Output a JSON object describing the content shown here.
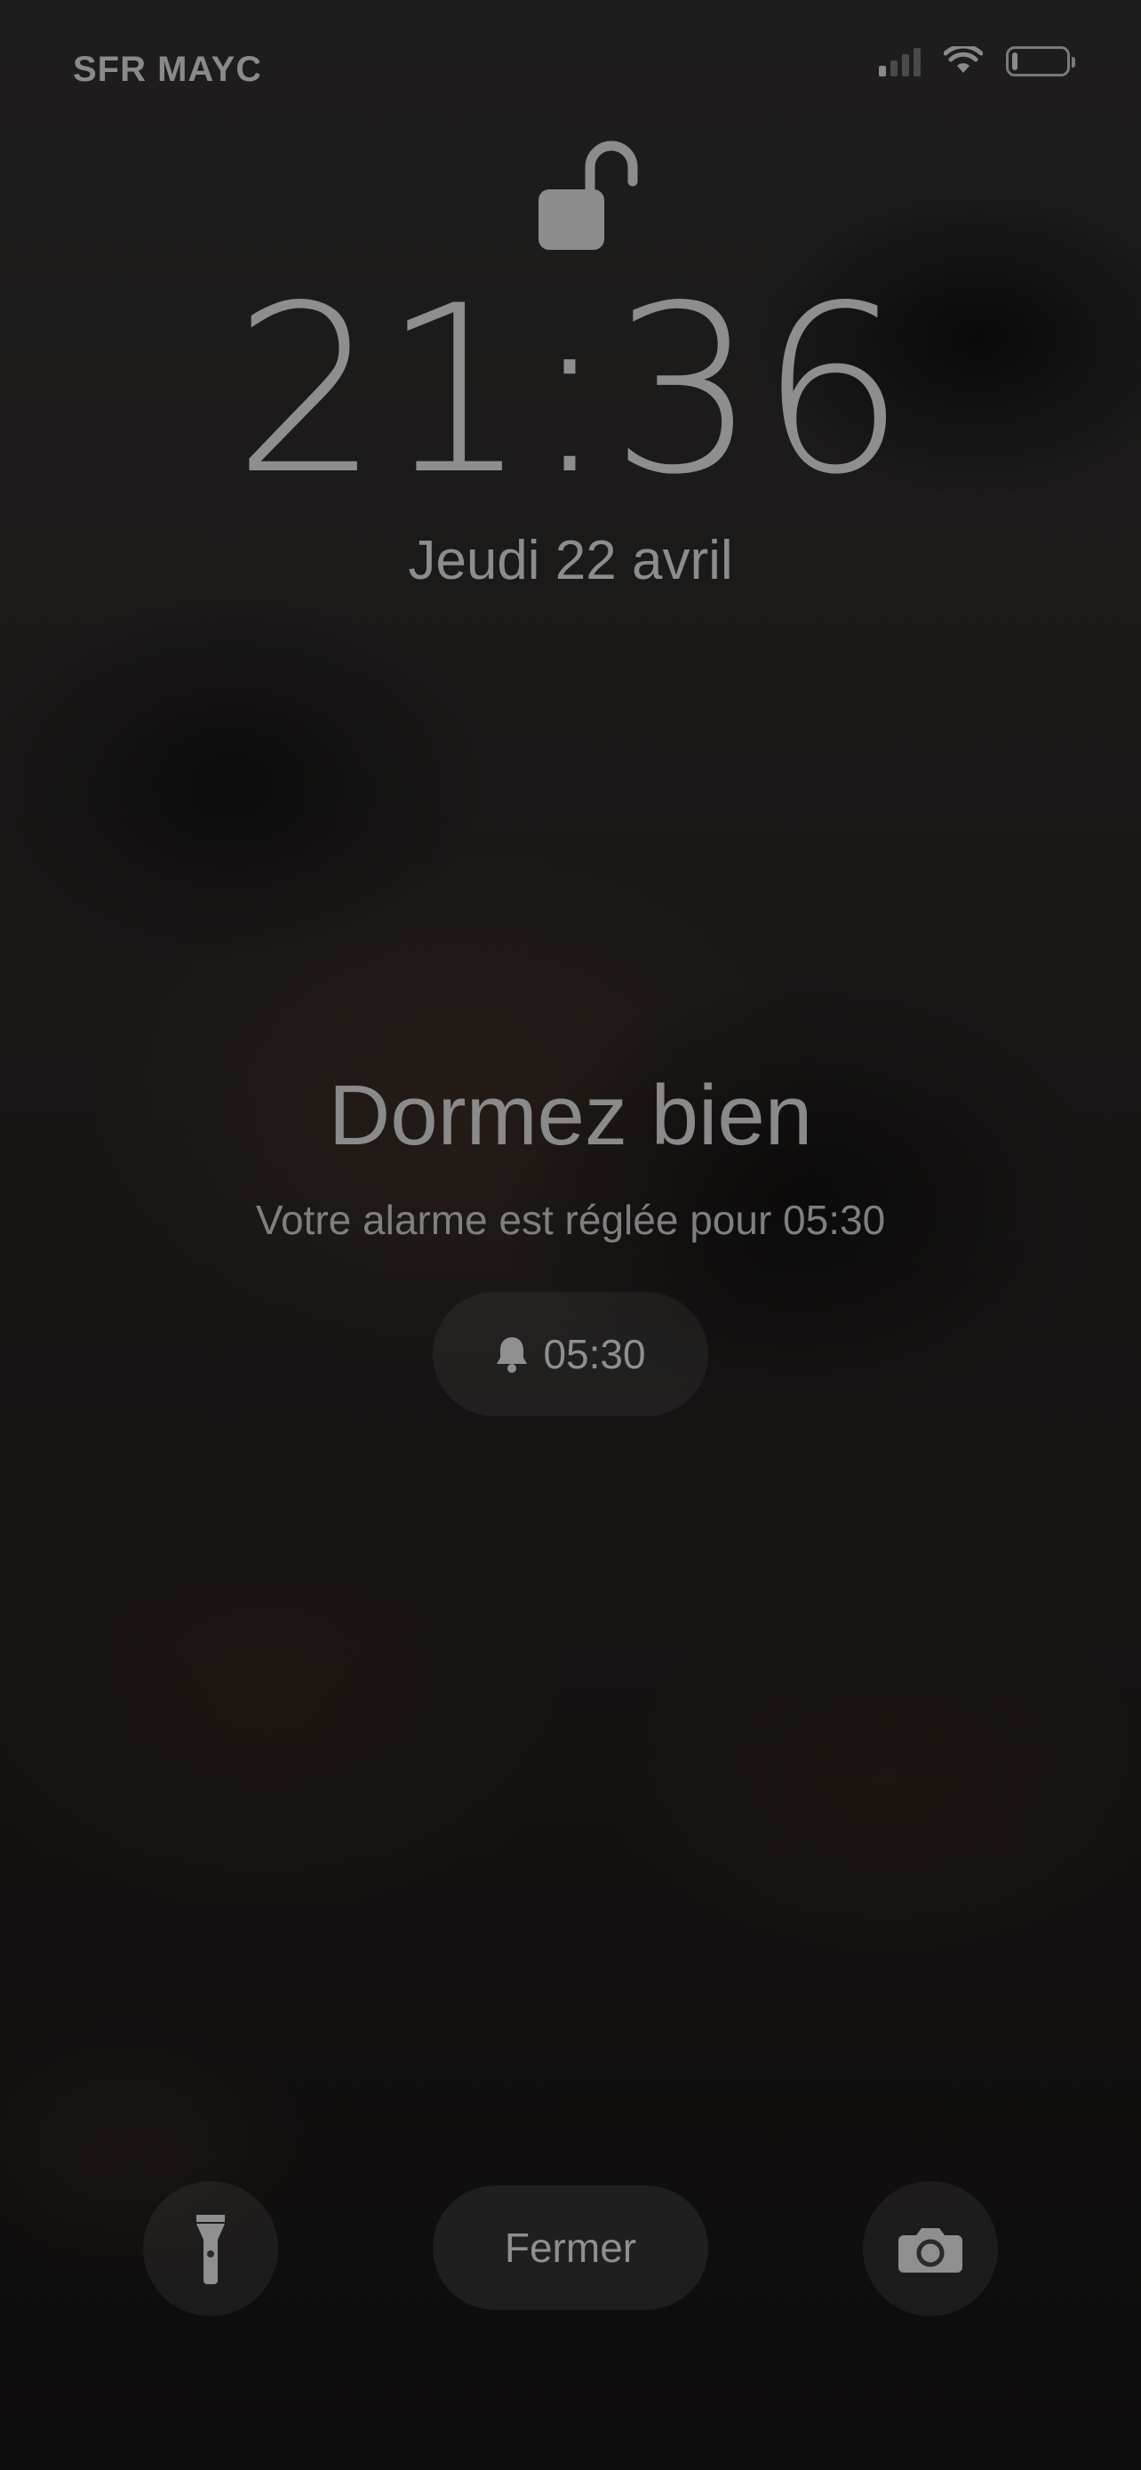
{
  "status_bar": {
    "carrier": "SFR MAYC",
    "icons": [
      "signal-icon",
      "wifi-icon",
      "battery-icon"
    ],
    "battery_level": 0.1
  },
  "lock_screen": {
    "lock_icon": "unlocked-padlock-icon",
    "time": "21:36",
    "date": "Jeudi 22 avril"
  },
  "sleep": {
    "greeting": "Dormez bien",
    "subtitle": "Votre alarme est réglée pour 05:30",
    "alarm_icon": "bell-icon",
    "alarm_time": "05:30"
  },
  "bottom_controls": {
    "flashlight_icon": "flashlight-icon",
    "close_label": "Fermer",
    "camera_icon": "camera-icon"
  }
}
